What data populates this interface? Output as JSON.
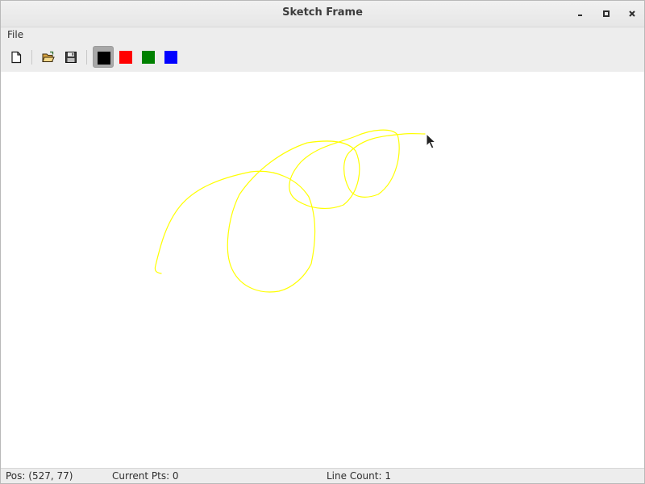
{
  "window": {
    "title": "Sketch Frame",
    "controls": [
      "minimize-icon",
      "maximize-icon",
      "close-icon"
    ]
  },
  "menubar": {
    "items": [
      {
        "label": "File"
      }
    ]
  },
  "toolbar": {
    "buttons": [
      {
        "icon": "new-file-icon"
      },
      {
        "icon": "open-folder-icon"
      },
      {
        "icon": "save-floppy-icon"
      }
    ],
    "colors": [
      {
        "name": "black",
        "hex": "#000000",
        "selected": true
      },
      {
        "name": "red",
        "hex": "#ff0000",
        "selected": false
      },
      {
        "name": "green",
        "hex": "#008000",
        "selected": false
      },
      {
        "name": "blue",
        "hex": "#0000ff",
        "selected": false
      }
    ]
  },
  "canvas": {
    "stroke_color": "#ffff00",
    "line_count": 1
  },
  "statusbar": {
    "position": "Pos: (527, 77)",
    "current_points": "Current Pts: 0",
    "line_count": "Line Count: 1"
  }
}
